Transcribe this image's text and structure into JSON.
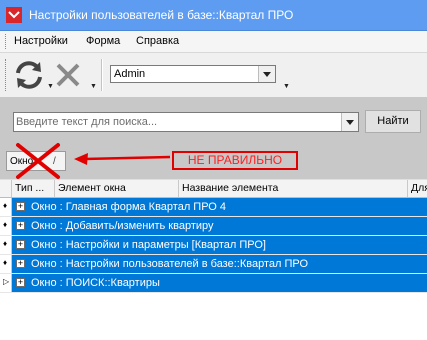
{
  "window": {
    "title": "Настройки пользователей в базе::Квартал ПРО"
  },
  "menu": {
    "items": [
      "Настройки",
      "Форма",
      "Справка"
    ]
  },
  "toolbar": {
    "refresh_icon": "refresh-icon",
    "cancel_icon": "close-icon",
    "user_select_value": "Admin"
  },
  "search": {
    "placeholder": "Введите текст для поиска...",
    "find_label": "Найти"
  },
  "filter_tab": {
    "label": "Окно",
    "suffix": "/"
  },
  "annotation": {
    "text": "НЕ ПРАВИЛЬНО",
    "color": "#e00000"
  },
  "grid": {
    "columns": [
      "Тип ...",
      "Элемент окна",
      "Название элемента",
      "Для"
    ],
    "rows": [
      {
        "marker": "♦",
        "text": "Окно : Главная форма Квартал ПРО 4"
      },
      {
        "marker": "♦",
        "text": "Окно : Добавить/изменить квартиру"
      },
      {
        "marker": "♦",
        "text": "Окно : Настройки и параметры [Квартал ПРО]"
      },
      {
        "marker": "♦",
        "text": "Окно : Настройки пользователей в базе::Квартал ПРО"
      },
      {
        "marker": "▷",
        "text": "Окно : ПОИСК::Квартиры"
      }
    ],
    "selection_color": "#0078d7"
  }
}
